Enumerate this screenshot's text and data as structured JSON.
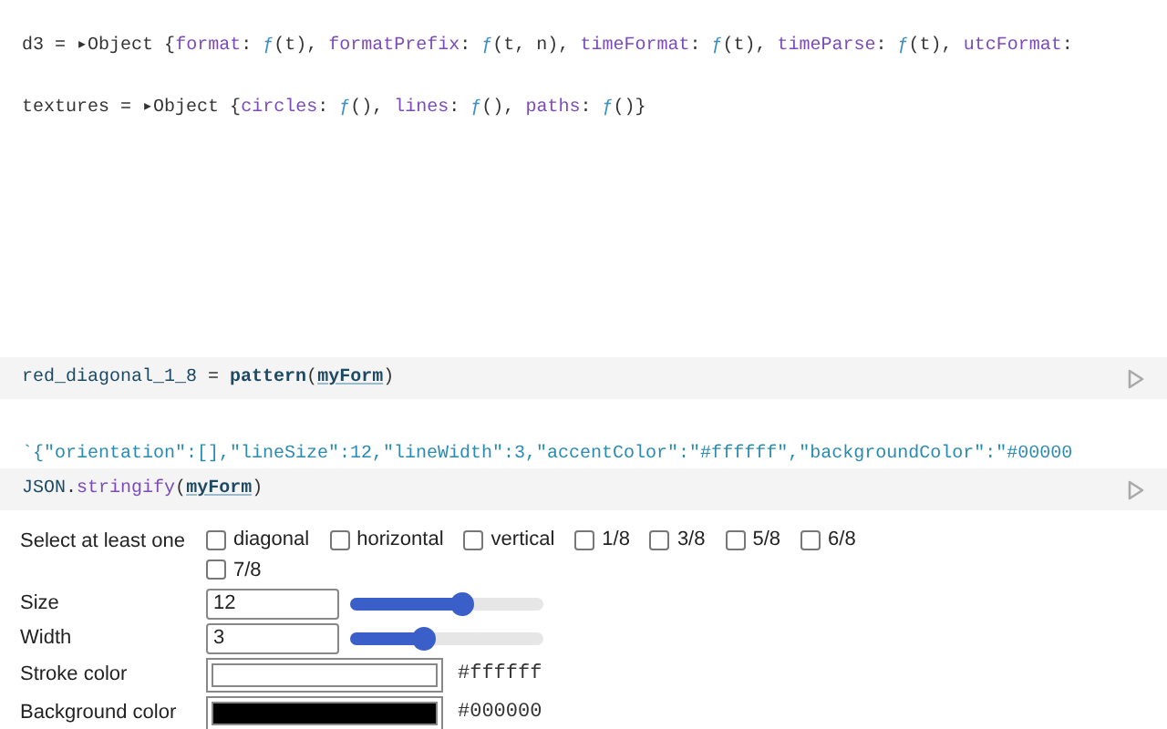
{
  "outputs": [
    {
      "tokens": [
        {
          "text": "d3 = ",
          "kind": "plain"
        },
        {
          "text": "▸",
          "kind": "plain"
        },
        {
          "text": "Object {",
          "kind": "plain"
        },
        {
          "text": "format",
          "kind": "key"
        },
        {
          "text": ": ",
          "kind": "plain"
        },
        {
          "text": "ƒ",
          "kind": "fn"
        },
        {
          "text": "(t), ",
          "kind": "plain"
        },
        {
          "text": "formatPrefix",
          "kind": "key"
        },
        {
          "text": ": ",
          "kind": "plain"
        },
        {
          "text": "ƒ",
          "kind": "fn"
        },
        {
          "text": "(t, n), ",
          "kind": "plain"
        },
        {
          "text": "timeFormat",
          "kind": "key"
        },
        {
          "text": ": ",
          "kind": "plain"
        },
        {
          "text": "ƒ",
          "kind": "fn"
        },
        {
          "text": "(t), ",
          "kind": "plain"
        },
        {
          "text": "timeParse",
          "kind": "key"
        },
        {
          "text": ": ",
          "kind": "plain"
        },
        {
          "text": "ƒ",
          "kind": "fn"
        },
        {
          "text": "(t), ",
          "kind": "plain"
        },
        {
          "text": "utcFormat",
          "kind": "key"
        },
        {
          "text": ":",
          "kind": "plain"
        }
      ]
    },
    {
      "tokens": [
        {
          "text": "textures = ",
          "kind": "plain"
        },
        {
          "text": "▸",
          "kind": "plain"
        },
        {
          "text": "Object {",
          "kind": "plain"
        },
        {
          "text": "circles",
          "kind": "key"
        },
        {
          "text": ": ",
          "kind": "plain"
        },
        {
          "text": "ƒ",
          "kind": "fn"
        },
        {
          "text": "(), ",
          "kind": "plain"
        },
        {
          "text": "lines",
          "kind": "key"
        },
        {
          "text": ": ",
          "kind": "plain"
        },
        {
          "text": "ƒ",
          "kind": "fn"
        },
        {
          "text": "(), ",
          "kind": "plain"
        },
        {
          "text": "paths",
          "kind": "key"
        },
        {
          "text": ": ",
          "kind": "plain"
        },
        {
          "text": "ƒ",
          "kind": "fn"
        },
        {
          "text": "()}",
          "kind": "plain"
        }
      ]
    }
  ],
  "cells": [
    {
      "tokens": [
        {
          "text": "red_diagonal_1_8",
          "kind": "var"
        },
        {
          "text": " = ",
          "kind": "plain"
        },
        {
          "text": "pattern",
          "kind": "bold"
        },
        {
          "text": "(",
          "kind": "plain"
        },
        {
          "text": "myForm",
          "kind": "ref"
        },
        {
          "text": ")",
          "kind": "plain"
        }
      ]
    },
    {
      "output": "`{\"orientation\":[],\"lineSize\":12,\"lineWidth\":3,\"accentColor\":\"#ffffff\",\"backgroundColor\":\"#00000",
      "tokens": [
        {
          "text": "JSON",
          "kind": "var"
        },
        {
          "text": ".",
          "kind": "plain"
        },
        {
          "text": "stringify",
          "kind": "method"
        },
        {
          "text": "(",
          "kind": "plain"
        },
        {
          "text": "myForm",
          "kind": "ref"
        },
        {
          "text": ")",
          "kind": "plain"
        }
      ]
    }
  ],
  "form": {
    "orientation": {
      "label": "Select at least one",
      "options": [
        {
          "label": "diagonal",
          "checked": false
        },
        {
          "label": "horizontal",
          "checked": false
        },
        {
          "label": "vertical",
          "checked": false
        },
        {
          "label": "1/8",
          "checked": false
        },
        {
          "label": "3/8",
          "checked": false
        },
        {
          "label": "5/8",
          "checked": false
        },
        {
          "label": "6/8",
          "checked": false
        },
        {
          "label": "7/8",
          "checked": false
        }
      ]
    },
    "sliders": [
      {
        "label": "Size",
        "value": "12",
        "level": 0.58
      },
      {
        "label": "Width",
        "value": "3",
        "level": 0.38
      }
    ],
    "colors": [
      {
        "label": "Stroke color",
        "color": "#ffffff",
        "value": "#ffffff"
      },
      {
        "label": "Background color",
        "color": "#000000",
        "value": "#000000"
      }
    ]
  }
}
